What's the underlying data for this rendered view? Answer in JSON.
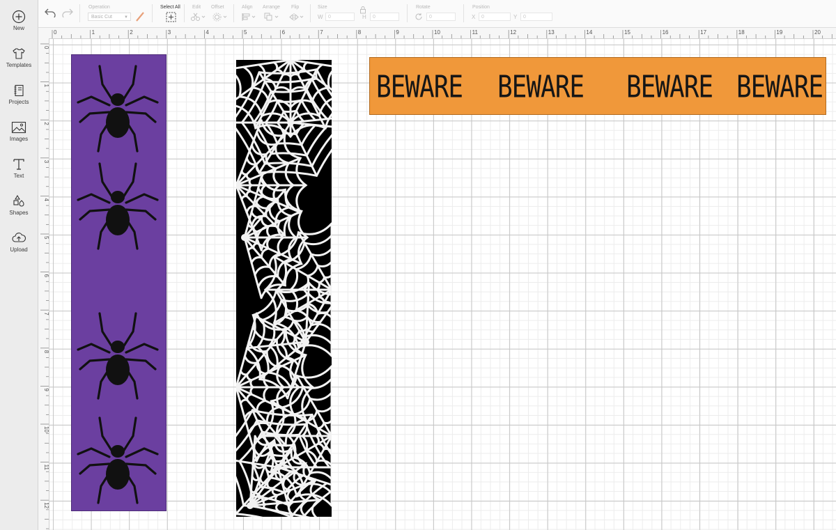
{
  "sidebar": {
    "items": [
      {
        "label": "New",
        "icon": "new-icon"
      },
      {
        "label": "Templates",
        "icon": "shirt-icon"
      },
      {
        "label": "Projects",
        "icon": "projects-icon"
      },
      {
        "label": "Images",
        "icon": "image-icon"
      },
      {
        "label": "Text",
        "icon": "text-icon"
      },
      {
        "label": "Shapes",
        "icon": "shapes-icon"
      },
      {
        "label": "Upload",
        "icon": "upload-icon"
      }
    ]
  },
  "toolbar": {
    "operation_label": "Operation",
    "operation_value": "Basic Cut",
    "select_all_label": "Select All",
    "edit_label": "Edit",
    "offset_label": "Offset",
    "align_label": "Align",
    "arrange_label": "Arrange",
    "flip_label": "Flip",
    "size_label": "Size",
    "size_w_letter": "W",
    "size_w_value": "0",
    "size_h_letter": "H",
    "size_h_value": "0",
    "rotate_label": "Rotate",
    "rotate_value": "0",
    "position_label": "Position",
    "pos_x_letter": "X",
    "pos_x_value": "0",
    "pos_y_letter": "Y",
    "pos_y_value": "0"
  },
  "ruler": {
    "top": [
      "0",
      "1",
      "2",
      "3",
      "4",
      "5",
      "6",
      "7",
      "8",
      "9",
      "10",
      "11",
      "12",
      "13",
      "14",
      "15",
      "16",
      "17",
      "18",
      "19",
      "20"
    ],
    "left": [
      "0",
      "1",
      "2",
      "3",
      "4",
      "5",
      "6",
      "7",
      "8",
      "9",
      "10",
      "11",
      "12"
    ]
  },
  "canvas": {
    "beware_text": [
      "BEWARE",
      "BEWARE",
      "BEWARE",
      "BEWARE"
    ],
    "strip_colors": {
      "purple": "#6b3fa0",
      "black": "#000000",
      "orange": "#f0983a"
    }
  }
}
